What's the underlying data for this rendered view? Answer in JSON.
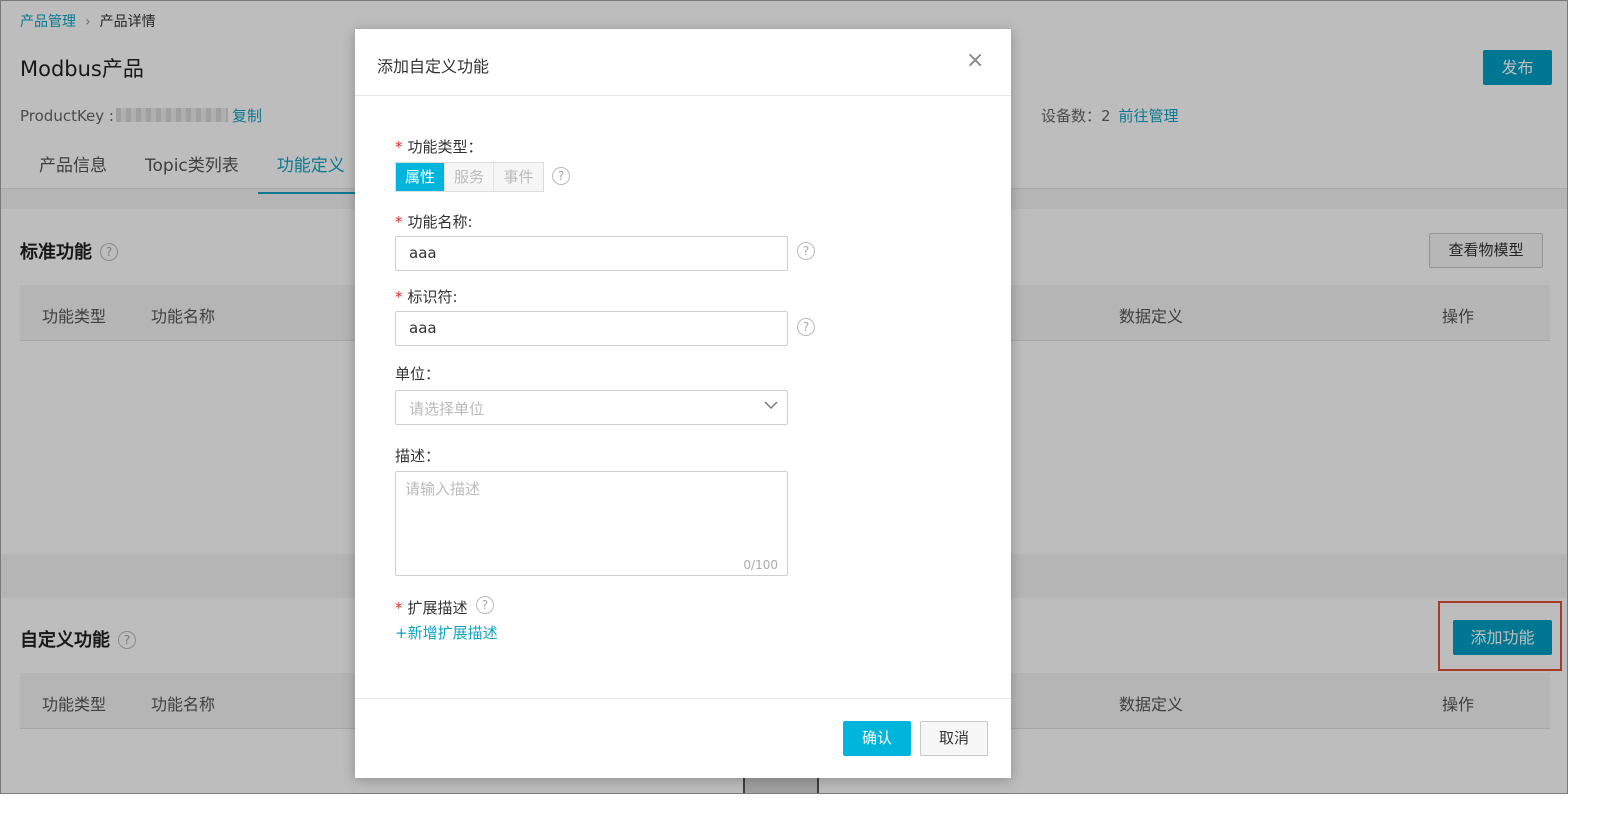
{
  "breadcrumb": {
    "root": "产品管理",
    "separator": "›",
    "current": "产品详情"
  },
  "product": {
    "title": "Modbus产品",
    "key_label": "ProductKey :",
    "copy_label": "复制",
    "device_count_label": "设备数：2",
    "manage_link": "前往管理",
    "publish_label": "发布"
  },
  "tabs": [
    {
      "label": "产品信息"
    },
    {
      "label": "Topic类列表"
    },
    {
      "label": "功能定义"
    }
  ],
  "standard": {
    "title": "标准功能",
    "view_model_label": "查看物模型",
    "columns": {
      "type": "功能类型",
      "name": "功能名称",
      "data_def": "数据定义",
      "action": "操作"
    }
  },
  "custom": {
    "title": "自定义功能",
    "add_label": "添加功能",
    "columns": {
      "type": "功能类型",
      "name": "功能名称",
      "data_def": "数据定义",
      "action": "操作"
    }
  },
  "modal": {
    "title": "添加自定义功能",
    "close_glyph": "×",
    "required_mark": "*",
    "help_glyph": "?",
    "type_label": "功能类型：",
    "type_options": [
      "属性",
      "服务",
      "事件"
    ],
    "name_label": "功能名称:",
    "name_value": "aaa",
    "identifier_label": "标识符:",
    "identifier_value": "aaa",
    "unit_label": "单位：",
    "unit_placeholder": "请选择单位",
    "desc_label": "描述：",
    "desc_placeholder": "请输入描述",
    "desc_counter": "0/100",
    "ext_label": "扩展描述",
    "ext_add_label": "+新增扩展描述",
    "ok_label": "确认",
    "cancel_label": "取消"
  },
  "colors": {
    "accent": "#00a1c5",
    "required": "#e0292e",
    "highlight": "#e0533a"
  }
}
